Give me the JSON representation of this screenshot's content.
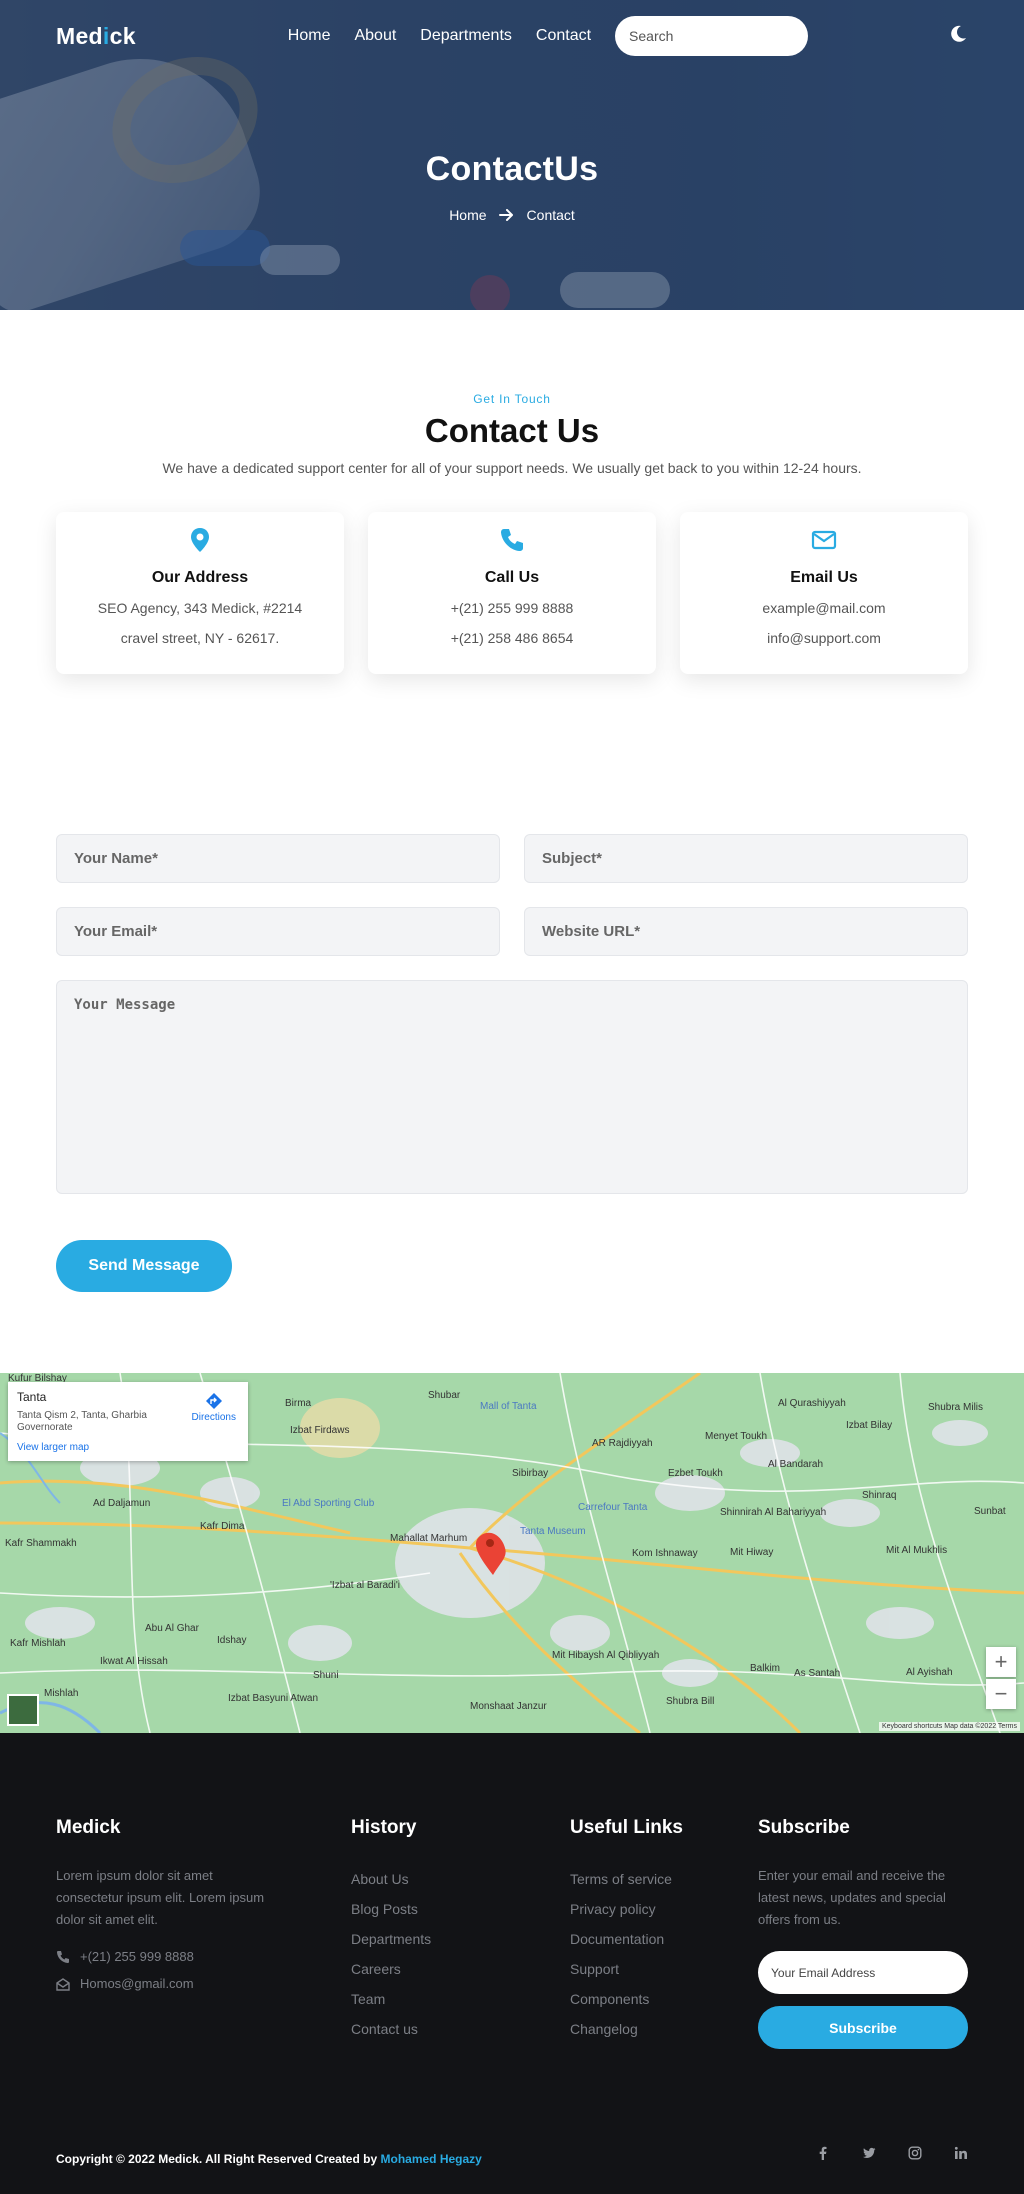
{
  "brand": {
    "logo_part1": "Med",
    "logo_accent": "i",
    "logo_part2": "ck"
  },
  "nav": {
    "items": [
      "Home",
      "About",
      "Departments",
      "Contact"
    ],
    "search_placeholder": "Search"
  },
  "hero": {
    "title": "ContactUs",
    "breadcrumb": {
      "home": "Home",
      "current": "Contact"
    }
  },
  "contact_section": {
    "eyebrow": "Get In Touch",
    "title": "Contact Us",
    "subtitle": "We have a dedicated support center for all of your support needs. We usually get back to you within 12-24 hours.",
    "cards": [
      {
        "icon": "map-pin-icon",
        "title": "Our Address",
        "line1": "SEO Agency, 343 Medick, #2214",
        "line2": "cravel street, NY - 62617."
      },
      {
        "icon": "phone-icon",
        "title": "Call Us",
        "line1": "+(21) 255 999 8888",
        "line2": "+(21) 258 486 8654"
      },
      {
        "icon": "envelope-icon",
        "title": "Email Us",
        "line1": "example@mail.com",
        "line2": "info@support.com"
      }
    ]
  },
  "form": {
    "name_placeholder": "Your Name*",
    "subject_placeholder": "Subject*",
    "email_placeholder": "Your Email*",
    "website_placeholder": "Website URL*",
    "message_placeholder": "Your Message",
    "submit_label": "Send Message"
  },
  "map": {
    "place_title": "Tanta",
    "place_address": "Tanta Qism 2, Tanta, Gharbia Governorate",
    "larger_map_link": "View larger map",
    "directions_label": "Directions",
    "zoom_in": "+",
    "zoom_out": "−",
    "attribution": "Keyboard shortcuts   Map data ©2022   Terms",
    "labels": [
      "Kufur Bilshay",
      "Birma",
      "Shubar",
      "Mall of Tanta",
      "Izbat Firdaws",
      "AR Rajdiyyah",
      "Menyet Toukh",
      "Al Qurashiyyah",
      "Izbat Bilay",
      "Shubra Milis",
      "Sibirbay",
      "Ezbet Toukh",
      "Al Bandarah",
      "Ad Daljamun",
      "El Abd Sporting Club",
      "Carrefour Tanta",
      "Tanta Museum",
      "Shinnirah Al Bahariyyah",
      "Shinraq",
      "Sunbat",
      "Kafr Dima",
      "Mahallat Marhum",
      "Kom Ishnaway",
      "Mit Hiway",
      "Mit Al Mukhlis",
      "Kafr Shammakh",
      "'Izbat al Baradi'i",
      "Abu Al Ghar",
      "Idshay",
      "Mit Hibaysh Al Qibliyyah",
      "Balkim",
      "As Santah",
      "Al Ayishah",
      "Kafr Mishlah",
      "Ikwat Al Hissah",
      "Shuni",
      "Izbat Basyuni Atwan",
      "Monshaat Janzur",
      "Shubra Bill",
      "Mishlah"
    ]
  },
  "footer": {
    "about": {
      "title": "Medick",
      "text": "Lorem ipsum dolor sit amet consectetur ipsum elit. Lorem ipsum dolor sit amet elit.",
      "phone": "+(21) 255 999 8888",
      "email": "Homos@gmail.com"
    },
    "history": {
      "title": "History",
      "links": [
        "About Us",
        "Blog Posts",
        "Departments",
        "Careers",
        "Team",
        "Contact us"
      ]
    },
    "useful": {
      "title": "Useful Links",
      "links": [
        "Terms of service",
        "Privacy policy",
        "Documentation",
        "Support",
        "Components",
        "Changelog"
      ]
    },
    "subscribe": {
      "title": "Subscribe",
      "text": "Enter your email and receive the latest news, updates and special offers from us.",
      "input_placeholder": "Your Email Address",
      "button_label": "Subscribe"
    },
    "copyright_prefix": "Copyright © 2022 Medick. All Right Reserved Created by ",
    "copyright_author": "Mohamed Hegazy",
    "socials": [
      "facebook-icon",
      "twitter-icon",
      "instagram-icon",
      "linkedin-icon"
    ]
  },
  "colors": {
    "accent": "#29abe2",
    "footer_bg": "#121316",
    "hero_overlay": "#2c4466"
  }
}
